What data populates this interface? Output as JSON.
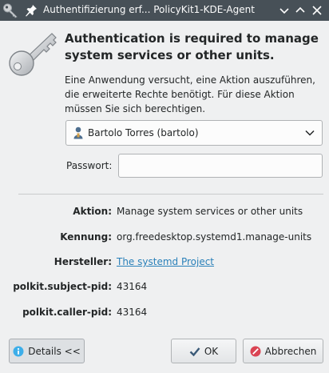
{
  "window": {
    "title": "Authentifizierung erf... PolicyKit1-KDE-Agent"
  },
  "header": {
    "heading": "Authentication is required to manage system services or other units.",
    "description": "Eine Anwendung versucht, eine Aktion auszuführen, die erweiterte Rechte benötigt. Für diese Aktion müssen Sie sich berechtigen."
  },
  "user_select": {
    "selected": "Bartolo Torres (bartolo)"
  },
  "password": {
    "label": "Passwort:",
    "value": ""
  },
  "details": {
    "action_label": "Aktion:",
    "action_value": "Manage system services or other units",
    "id_label": "Kennung:",
    "id_value": "org.freedesktop.systemd1.manage-units",
    "vendor_label": "Hersteller:",
    "vendor_value": "The systemd Project",
    "subject_pid_label": "polkit.subject-pid:",
    "subject_pid_value": "43164",
    "caller_pid_label": "polkit.caller-pid:",
    "caller_pid_value": "43164"
  },
  "buttons": {
    "details": "Details <<",
    "ok": "OK",
    "cancel": "Abbrechen"
  },
  "colors": {
    "titlebar": "#475057",
    "background": "#eff0f1",
    "link": "#2980b9",
    "info_icon": "#3daee9",
    "ok_icon": "#3a5a78",
    "cancel_icon": "#da4453"
  }
}
